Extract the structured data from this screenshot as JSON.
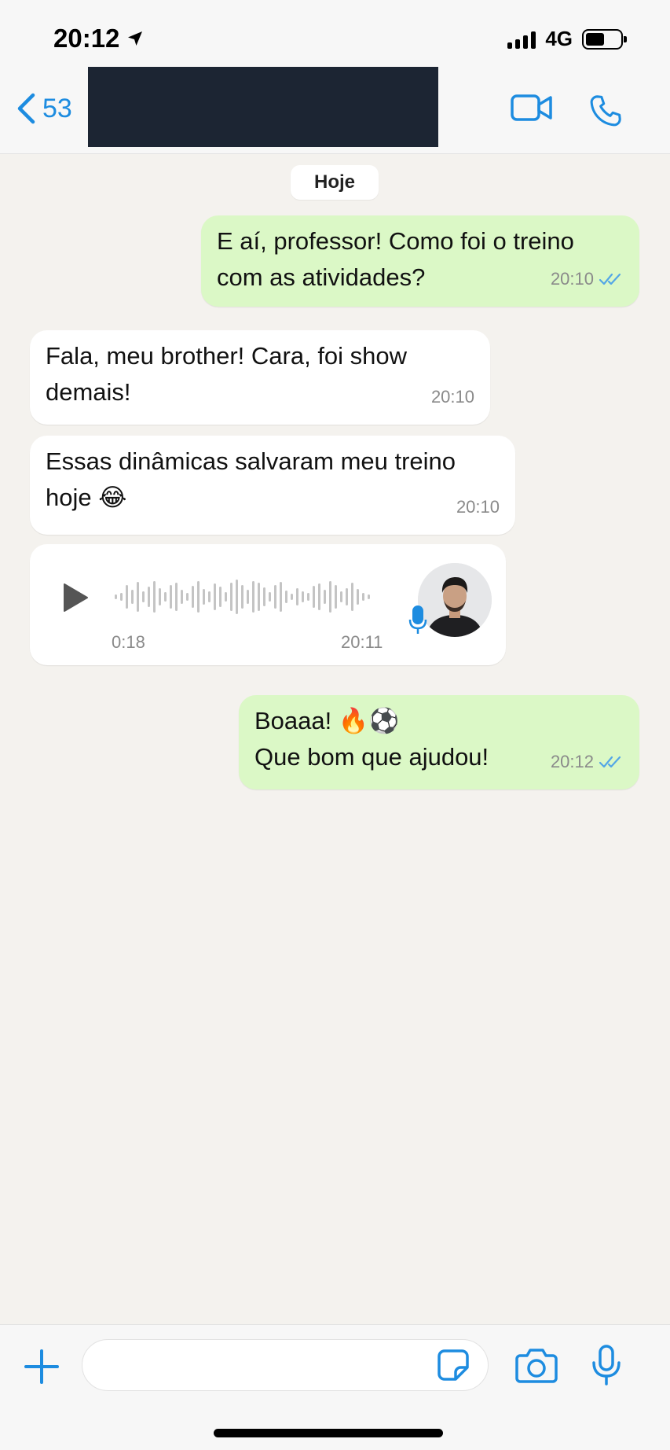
{
  "status_bar": {
    "time": "20:12",
    "network": "4G"
  },
  "header": {
    "back_count": "53"
  },
  "date_separator": "Hoje",
  "messages": [
    {
      "direction": "out",
      "text": "E aí, professor! Como foi o treino\ncom as atividades?",
      "time": "20:10",
      "status": "read"
    },
    {
      "direction": "in",
      "text": "Fala, meu brother! Cara, foi show\ndemais!",
      "time": "20:10"
    },
    {
      "direction": "in",
      "text": "Essas dinâmicas salvaram meu treino\nhoje 😂",
      "time": "20:10"
    },
    {
      "direction": "in",
      "type": "audio",
      "duration": "0:18",
      "time": "20:11"
    },
    {
      "direction": "out",
      "text": "Boaaa! 🔥⚽\nQue bom que ajudou!",
      "time": "20:12",
      "status": "read"
    }
  ],
  "composer": {
    "placeholder": ""
  },
  "colors": {
    "accent": "#1d8ce0",
    "outgoing_bubble": "#dbf8c6",
    "incoming_bubble": "#ffffff",
    "read_ticks": "#53a6e6"
  }
}
